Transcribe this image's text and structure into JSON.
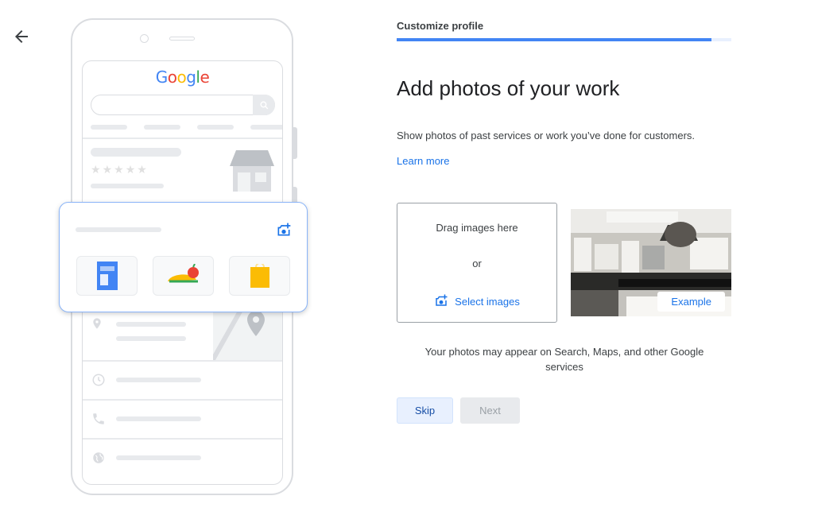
{
  "step": {
    "label": "Customize profile",
    "progress": 0.94
  },
  "page": {
    "title": "Add photos of your work",
    "description": "Show photos of past services or work you’ve done for customers.",
    "learn_more": "Learn more"
  },
  "upload": {
    "drag_text": "Drag images here",
    "or_text": "or",
    "select_label": "Select images"
  },
  "example": {
    "badge": "Example"
  },
  "note": "Your photos may appear on Search, Maps, and other Google services",
  "buttons": {
    "skip": "Skip",
    "next": "Next"
  },
  "illustration": {
    "logo_letters": [
      {
        "char": "G",
        "color": "#4285F4"
      },
      {
        "char": "o",
        "color": "#EA4335"
      },
      {
        "char": "o",
        "color": "#FBBC05"
      },
      {
        "char": "g",
        "color": "#4285F4"
      },
      {
        "char": "l",
        "color": "#34A853"
      },
      {
        "char": "e",
        "color": "#EA4335"
      }
    ],
    "rating_stars": 5
  },
  "icons": {
    "back": "arrow-back-icon",
    "add_photo": "add-photo-icon",
    "search": "search-icon",
    "location": "location-pin-icon",
    "clock": "clock-icon",
    "phone": "phone-icon",
    "globe": "globe-icon"
  },
  "colors": {
    "accent": "#1a73e8",
    "progress": "#4285f4"
  }
}
